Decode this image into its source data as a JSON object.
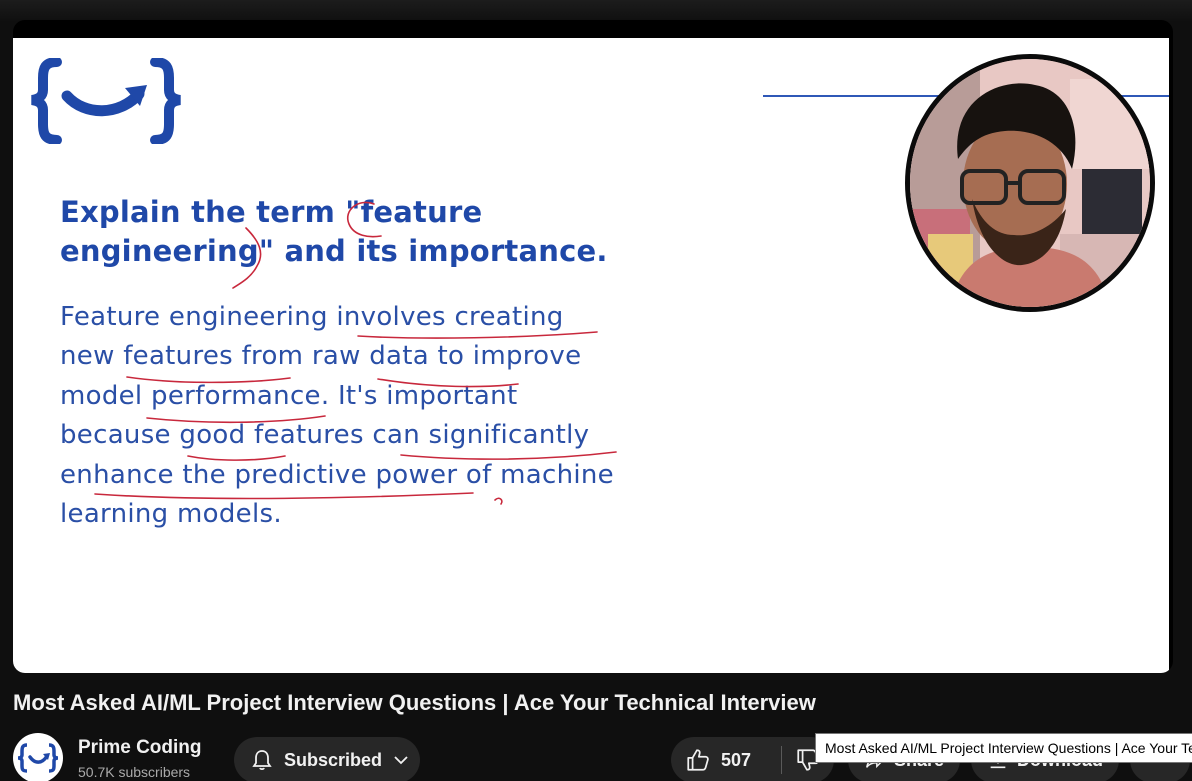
{
  "slide": {
    "question_line1": "Explain the term \"feature",
    "question_line2": "engineering\" and its importance.",
    "answer_lines": [
      "Feature engineering involves creating",
      "new features from raw data to improve",
      "model performance. It's important",
      "because good features can significantly",
      "enhance the predictive power of machine",
      "learning models."
    ]
  },
  "video": {
    "title": "Most Asked AI/ML Project Interview Questions | Ace Your Technical Interview"
  },
  "channel": {
    "name": "Prime Coding",
    "subscribers": "50.7K subscribers"
  },
  "actions": {
    "subscribe_label": "Subscribed",
    "like_count": "507",
    "share_label": "Share",
    "download_label": "Download"
  },
  "tooltip": {
    "text": "Most Asked AI/ML Project Interview Questions | Ace Your Technical Interview"
  },
  "colors": {
    "brand_blue": "#1f48a8",
    "ink_red": "#c8283c",
    "page_bg": "#0f0f0f",
    "button_bg": "#272727"
  },
  "icons": [
    "logo-icon",
    "bell-icon",
    "chevron-down-icon",
    "thumbs-up-icon",
    "thumbs-down-icon",
    "share-icon",
    "download-icon",
    "more-icon"
  ]
}
